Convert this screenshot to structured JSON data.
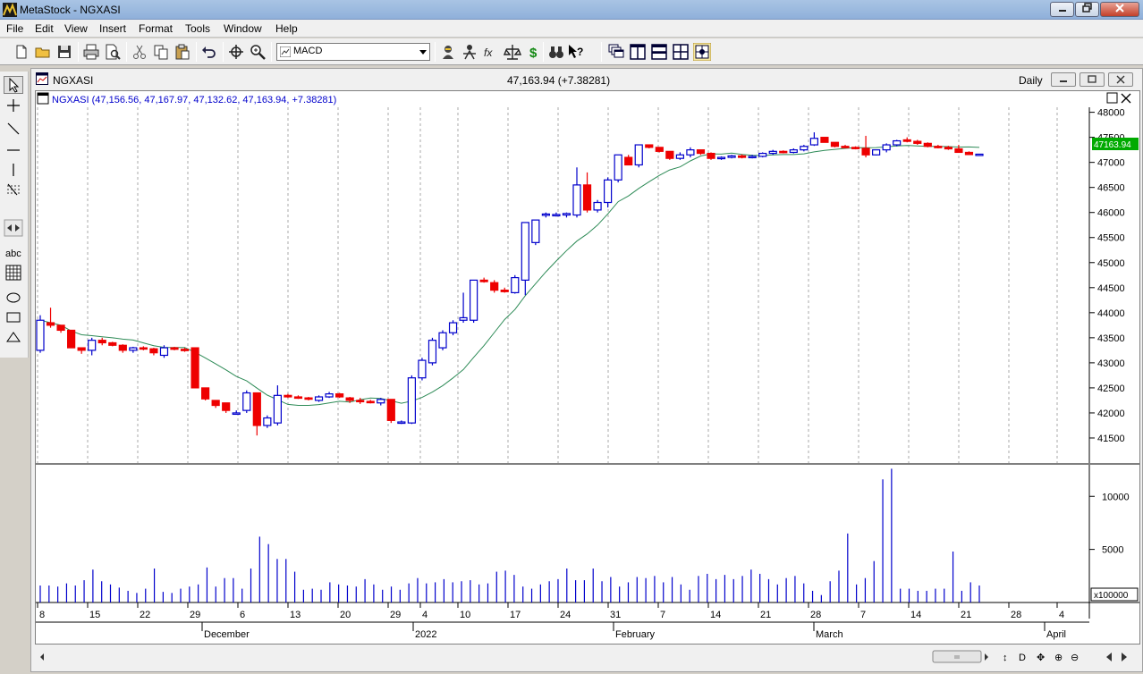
{
  "window": {
    "title": "MetaStock - NGXASI"
  },
  "menu": [
    "File",
    "Edit",
    "View",
    "Insert",
    "Format",
    "Tools",
    "Window",
    "Help"
  ],
  "toolbar": {
    "indicator_value": "MACD"
  },
  "chart_window": {
    "title": "NGXASI",
    "price_summary": "47,163.94 (+7.38281)",
    "period": "Daily"
  },
  "price_pane": {
    "header": "NGXASI (47,156.56, 47,167.97, 47,132.62, 47,163.94, +7.38281)",
    "last_price_label": "47163.94",
    "scale_multiplier_label": "x100000"
  },
  "colors": {
    "up": "#0000cc",
    "down": "#ee0000",
    "ma": "#2e8b57",
    "last_badge": "#00aa00"
  },
  "chart_data": [
    {
      "type": "candlestick",
      "pane": "price",
      "y_axis_ticks": [
        41500,
        42000,
        42500,
        43000,
        43500,
        44000,
        44500,
        45000,
        45500,
        46000,
        46500,
        47000,
        47500,
        48000
      ],
      "ylim": [
        41000,
        48100
      ],
      "x_tick_labels": [
        "8",
        "15",
        "22",
        "29",
        "6",
        "13",
        "20",
        "29",
        "4",
        "10",
        "17",
        "24",
        "31",
        "7",
        "14",
        "21",
        "28",
        "7",
        "14",
        "21",
        "28",
        "4"
      ],
      "month_labels": [
        "December",
        "2022",
        "February",
        "March",
        "April"
      ],
      "candles": [
        {
          "o": 43250,
          "h": 43950,
          "l": 43200,
          "c": 43850
        },
        {
          "o": 43800,
          "h": 44100,
          "l": 43700,
          "c": 43750
        },
        {
          "o": 43750,
          "h": 43750,
          "l": 43600,
          "c": 43650
        },
        {
          "o": 43650,
          "h": 43650,
          "l": 43300,
          "c": 43300
        },
        {
          "o": 43300,
          "h": 43300,
          "l": 43180,
          "c": 43250
        },
        {
          "o": 43250,
          "h": 43500,
          "l": 43150,
          "c": 43450
        },
        {
          "o": 43450,
          "h": 43500,
          "l": 43350,
          "c": 43400
        },
        {
          "o": 43400,
          "h": 43420,
          "l": 43330,
          "c": 43350
        },
        {
          "o": 43350,
          "h": 43370,
          "l": 43200,
          "c": 43250
        },
        {
          "o": 43250,
          "h": 43320,
          "l": 43200,
          "c": 43300
        },
        {
          "o": 43300,
          "h": 43330,
          "l": 43250,
          "c": 43280
        },
        {
          "o": 43280,
          "h": 43300,
          "l": 43150,
          "c": 43200
        },
        {
          "o": 43150,
          "h": 43350,
          "l": 43100,
          "c": 43300
        },
        {
          "o": 43300,
          "h": 43320,
          "l": 43250,
          "c": 43270
        },
        {
          "o": 43270,
          "h": 43300,
          "l": 43220,
          "c": 43250
        },
        {
          "o": 43300,
          "h": 43300,
          "l": 42500,
          "c": 42500
        },
        {
          "o": 42500,
          "h": 42500,
          "l": 42250,
          "c": 42280
        },
        {
          "o": 42250,
          "h": 42250,
          "l": 42100,
          "c": 42150
        },
        {
          "o": 42200,
          "h": 42200,
          "l": 42000,
          "c": 42050
        },
        {
          "o": 42000,
          "h": 42050,
          "l": 41970,
          "c": 42000
        },
        {
          "o": 42050,
          "h": 42450,
          "l": 42000,
          "c": 42400
        },
        {
          "o": 42400,
          "h": 42400,
          "l": 41550,
          "c": 41750
        },
        {
          "o": 41750,
          "h": 41950,
          "l": 41700,
          "c": 41900
        },
        {
          "o": 41800,
          "h": 42550,
          "l": 41750,
          "c": 42350
        },
        {
          "o": 42350,
          "h": 42380,
          "l": 42300,
          "c": 42320
        },
        {
          "o": 42320,
          "h": 42350,
          "l": 42280,
          "c": 42300
        },
        {
          "o": 42300,
          "h": 42320,
          "l": 42250,
          "c": 42280
        },
        {
          "o": 42250,
          "h": 42350,
          "l": 42220,
          "c": 42320
        },
        {
          "o": 42320,
          "h": 42420,
          "l": 42300,
          "c": 42380
        },
        {
          "o": 42380,
          "h": 42400,
          "l": 42300,
          "c": 42320
        },
        {
          "o": 42300,
          "h": 42320,
          "l": 42200,
          "c": 42250
        },
        {
          "o": 42250,
          "h": 42300,
          "l": 42180,
          "c": 42230
        },
        {
          "o": 42230,
          "h": 42260,
          "l": 42190,
          "c": 42220
        },
        {
          "o": 42200,
          "h": 42300,
          "l": 42150,
          "c": 42270
        },
        {
          "o": 42270,
          "h": 42270,
          "l": 41800,
          "c": 41850
        },
        {
          "o": 41800,
          "h": 41850,
          "l": 41780,
          "c": 41820
        },
        {
          "o": 41800,
          "h": 42750,
          "l": 41780,
          "c": 42700
        },
        {
          "o": 42700,
          "h": 43100,
          "l": 42650,
          "c": 43050
        },
        {
          "o": 43000,
          "h": 43500,
          "l": 42950,
          "c": 43450
        },
        {
          "o": 43300,
          "h": 43650,
          "l": 43250,
          "c": 43600
        },
        {
          "o": 43600,
          "h": 43850,
          "l": 43550,
          "c": 43800
        },
        {
          "o": 43850,
          "h": 44400,
          "l": 43800,
          "c": 43900
        },
        {
          "o": 43850,
          "h": 44650,
          "l": 43800,
          "c": 44650
        },
        {
          "o": 44650,
          "h": 44700,
          "l": 44600,
          "c": 44620
        },
        {
          "o": 44600,
          "h": 44650,
          "l": 44400,
          "c": 44450
        },
        {
          "o": 44450,
          "h": 44500,
          "l": 44400,
          "c": 44420
        },
        {
          "o": 44400,
          "h": 44750,
          "l": 44380,
          "c": 44700
        },
        {
          "o": 44650,
          "h": 45800,
          "l": 44350,
          "c": 45800
        },
        {
          "o": 45400,
          "h": 45850,
          "l": 45350,
          "c": 45850
        },
        {
          "o": 45950,
          "h": 46000,
          "l": 45900,
          "c": 45970
        },
        {
          "o": 45950,
          "h": 46000,
          "l": 45920,
          "c": 45960
        },
        {
          "o": 45950,
          "h": 46000,
          "l": 45900,
          "c": 45980
        },
        {
          "o": 45950,
          "h": 46900,
          "l": 45900,
          "c": 46550
        },
        {
          "o": 46550,
          "h": 46800,
          "l": 46000,
          "c": 46050
        },
        {
          "o": 46050,
          "h": 46250,
          "l": 46000,
          "c": 46200
        },
        {
          "o": 46200,
          "h": 46700,
          "l": 46100,
          "c": 46650
        },
        {
          "o": 46650,
          "h": 47150,
          "l": 46600,
          "c": 47150
        },
        {
          "o": 47100,
          "h": 47150,
          "l": 46950,
          "c": 46950
        },
        {
          "o": 46950,
          "h": 47350,
          "l": 46900,
          "c": 47350
        },
        {
          "o": 47350,
          "h": 47350,
          "l": 47280,
          "c": 47300
        },
        {
          "o": 47300,
          "h": 47300,
          "l": 47200,
          "c": 47220
        },
        {
          "o": 47220,
          "h": 47220,
          "l": 47050,
          "c": 47080
        },
        {
          "o": 47080,
          "h": 47200,
          "l": 47050,
          "c": 47150
        },
        {
          "o": 47150,
          "h": 47300,
          "l": 47100,
          "c": 47250
        },
        {
          "o": 47250,
          "h": 47250,
          "l": 47150,
          "c": 47180
        },
        {
          "o": 47180,
          "h": 47200,
          "l": 47050,
          "c": 47080
        },
        {
          "o": 47080,
          "h": 47120,
          "l": 47050,
          "c": 47100
        },
        {
          "o": 47100,
          "h": 47150,
          "l": 47080,
          "c": 47130
        },
        {
          "o": 47130,
          "h": 47160,
          "l": 47080,
          "c": 47100
        },
        {
          "o": 47100,
          "h": 47150,
          "l": 47080,
          "c": 47120
        },
        {
          "o": 47120,
          "h": 47200,
          "l": 47100,
          "c": 47180
        },
        {
          "o": 47180,
          "h": 47250,
          "l": 47150,
          "c": 47220
        },
        {
          "o": 47220,
          "h": 47240,
          "l": 47180,
          "c": 47200
        },
        {
          "o": 47200,
          "h": 47280,
          "l": 47180,
          "c": 47250
        },
        {
          "o": 47250,
          "h": 47350,
          "l": 47220,
          "c": 47320
        },
        {
          "o": 47350,
          "h": 47600,
          "l": 47330,
          "c": 47480
        },
        {
          "o": 47500,
          "h": 47500,
          "l": 47400,
          "c": 47400
        },
        {
          "o": 47400,
          "h": 47400,
          "l": 47300,
          "c": 47320
        },
        {
          "o": 47320,
          "h": 47350,
          "l": 47280,
          "c": 47300
        },
        {
          "o": 47300,
          "h": 47320,
          "l": 47260,
          "c": 47280
        },
        {
          "o": 47280,
          "h": 47530,
          "l": 47100,
          "c": 47150
        },
        {
          "o": 47150,
          "h": 47250,
          "l": 47140,
          "c": 47250
        },
        {
          "o": 47250,
          "h": 47380,
          "l": 47200,
          "c": 47350
        },
        {
          "o": 47350,
          "h": 47450,
          "l": 47320,
          "c": 47430
        },
        {
          "o": 47450,
          "h": 47500,
          "l": 47400,
          "c": 47420
        },
        {
          "o": 47420,
          "h": 47450,
          "l": 47350,
          "c": 47380
        },
        {
          "o": 47380,
          "h": 47400,
          "l": 47300,
          "c": 47320
        },
        {
          "o": 47320,
          "h": 47350,
          "l": 47280,
          "c": 47300
        },
        {
          "o": 47300,
          "h": 47330,
          "l": 47250,
          "c": 47270
        },
        {
          "o": 47270,
          "h": 47350,
          "l": 47200,
          "c": 47200
        },
        {
          "o": 47200,
          "h": 47220,
          "l": 47150,
          "c": 47156
        },
        {
          "o": 47157,
          "h": 47168,
          "l": 47133,
          "c": 47164
        }
      ]
    },
    {
      "type": "bar",
      "pane": "volume",
      "y_axis_ticks": [
        5000,
        10000
      ],
      "ylim": [
        0,
        12800
      ],
      "values": [
        1600,
        1600,
        1500,
        1800,
        1600,
        2100,
        3100,
        2000,
        1700,
        1400,
        1100,
        900,
        1300,
        3200,
        1000,
        900,
        1300,
        1500,
        1700,
        3300,
        1500,
        2300,
        2300,
        1300,
        3200,
        6200,
        5500,
        4100,
        4100,
        2900,
        1200,
        1300,
        1200,
        1900,
        1700,
        1600,
        1500,
        2200,
        1700,
        1200,
        1500,
        1200,
        1800,
        2300,
        1800,
        1900,
        2200,
        1900,
        2000,
        2100,
        1700,
        1800,
        2900,
        3000,
        2600,
        1500,
        1300,
        1700,
        2000,
        2200,
        3200,
        2100,
        2100,
        3200,
        2000,
        2400,
        1500,
        1900,
        2400,
        2300,
        2500,
        1900,
        2400,
        1700,
        1200,
        2500,
        2700,
        2200,
        2600,
        2200,
        2500,
        3100,
        2700,
        2200,
        1700,
        2300,
        2500,
        1800,
        1100,
        700,
        2000,
        3000,
        6500,
        1700,
        2300,
        3900,
        11600,
        12600,
        1300,
        1300,
        1100,
        1100,
        1300,
        1300,
        4800,
        1100,
        1900,
        1600
      ]
    }
  ]
}
